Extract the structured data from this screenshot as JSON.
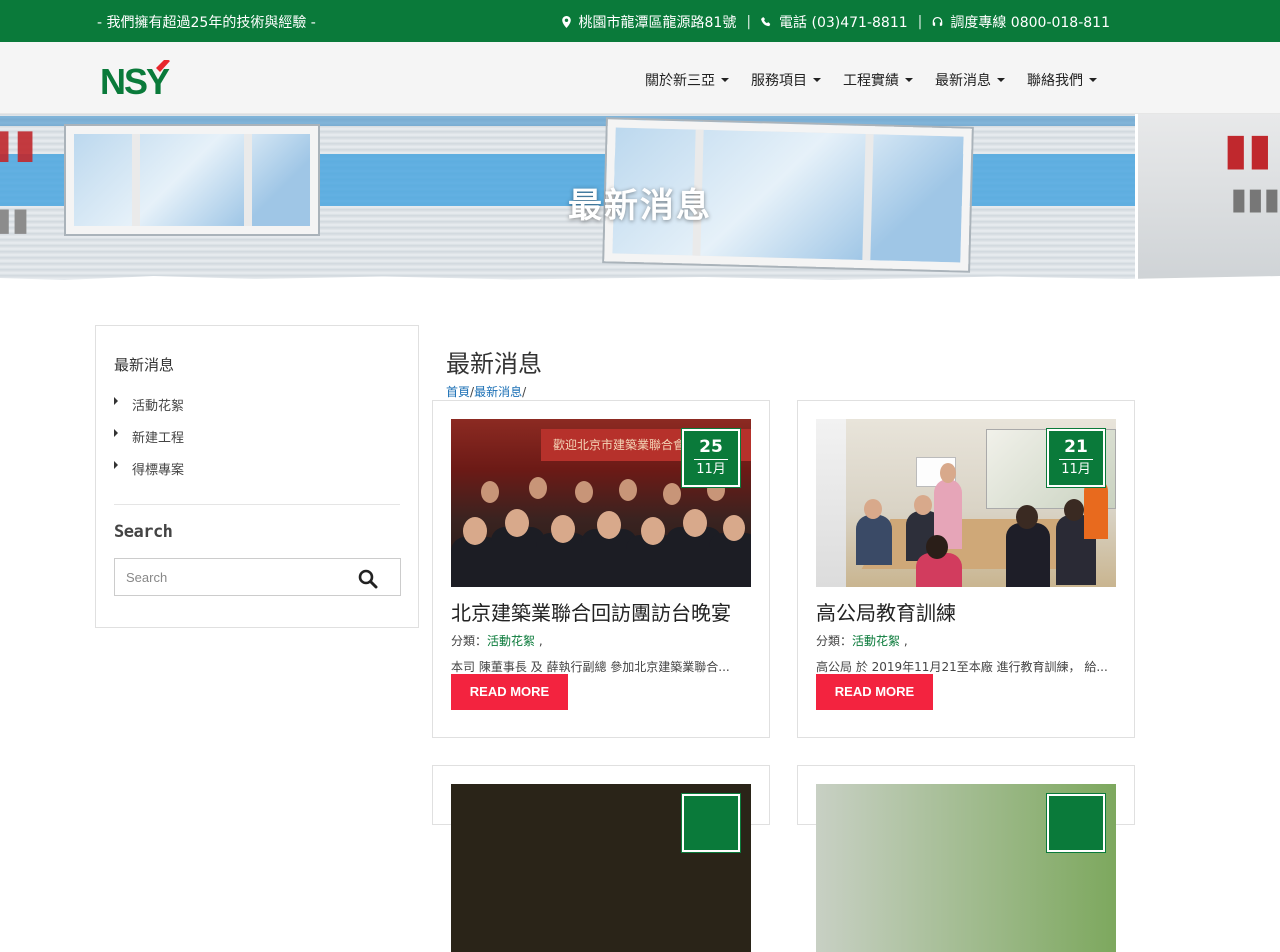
{
  "topbar": {
    "slogan": "- 我們擁有超過25年的技術與經驗 -",
    "address": "桃園市龍潭區龍源路81號",
    "phone": "電話 (03)471-8811",
    "hotline": "調度專線 0800-018-811",
    "separator": "|"
  },
  "header": {
    "logo_text": "NSY",
    "nav": [
      {
        "label": "關於新三亞"
      },
      {
        "label": "服務項目"
      },
      {
        "label": "工程實績"
      },
      {
        "label": "最新消息"
      },
      {
        "label": "聯絡我們"
      }
    ]
  },
  "banner": {
    "title": "最新消息"
  },
  "sidebar": {
    "heading": "最新消息",
    "categories": [
      {
        "label": "活動花絮"
      },
      {
        "label": "新建工程"
      },
      {
        "label": "得標專案"
      }
    ],
    "search_title": "Search",
    "search_placeholder": "Search"
  },
  "main": {
    "title": "最新消息",
    "breadcrumb": {
      "home": "首頁",
      "current": "最新消息",
      "sep": "/"
    }
  },
  "posts": [
    {
      "day": "25",
      "month": "11月",
      "title": "北京建築業聯合回訪團訪台晚宴",
      "category_prefix": "分類：",
      "category": "活動花絮",
      "category_suffix": " ,",
      "excerpt": "本司 陳董事長 及 薛執行副總 參加北京建築業聯合...",
      "read_more": "READ MORE",
      "photo_banner": "歡迎北京市建築業聯合會回"
    },
    {
      "day": "21",
      "month": "11月",
      "title": "高公局教育訓練",
      "category_prefix": "分類：",
      "category": "活動花絮",
      "category_suffix": " ,",
      "excerpt": "高公局 於 2019年11月21至本廠 進行教育訓練， 給...",
      "read_more": "READ MORE"
    }
  ],
  "colors": {
    "brand_green": "#0a7a3a",
    "read_more_red": "#f3233f",
    "link_blue": "#1a6fb5"
  }
}
